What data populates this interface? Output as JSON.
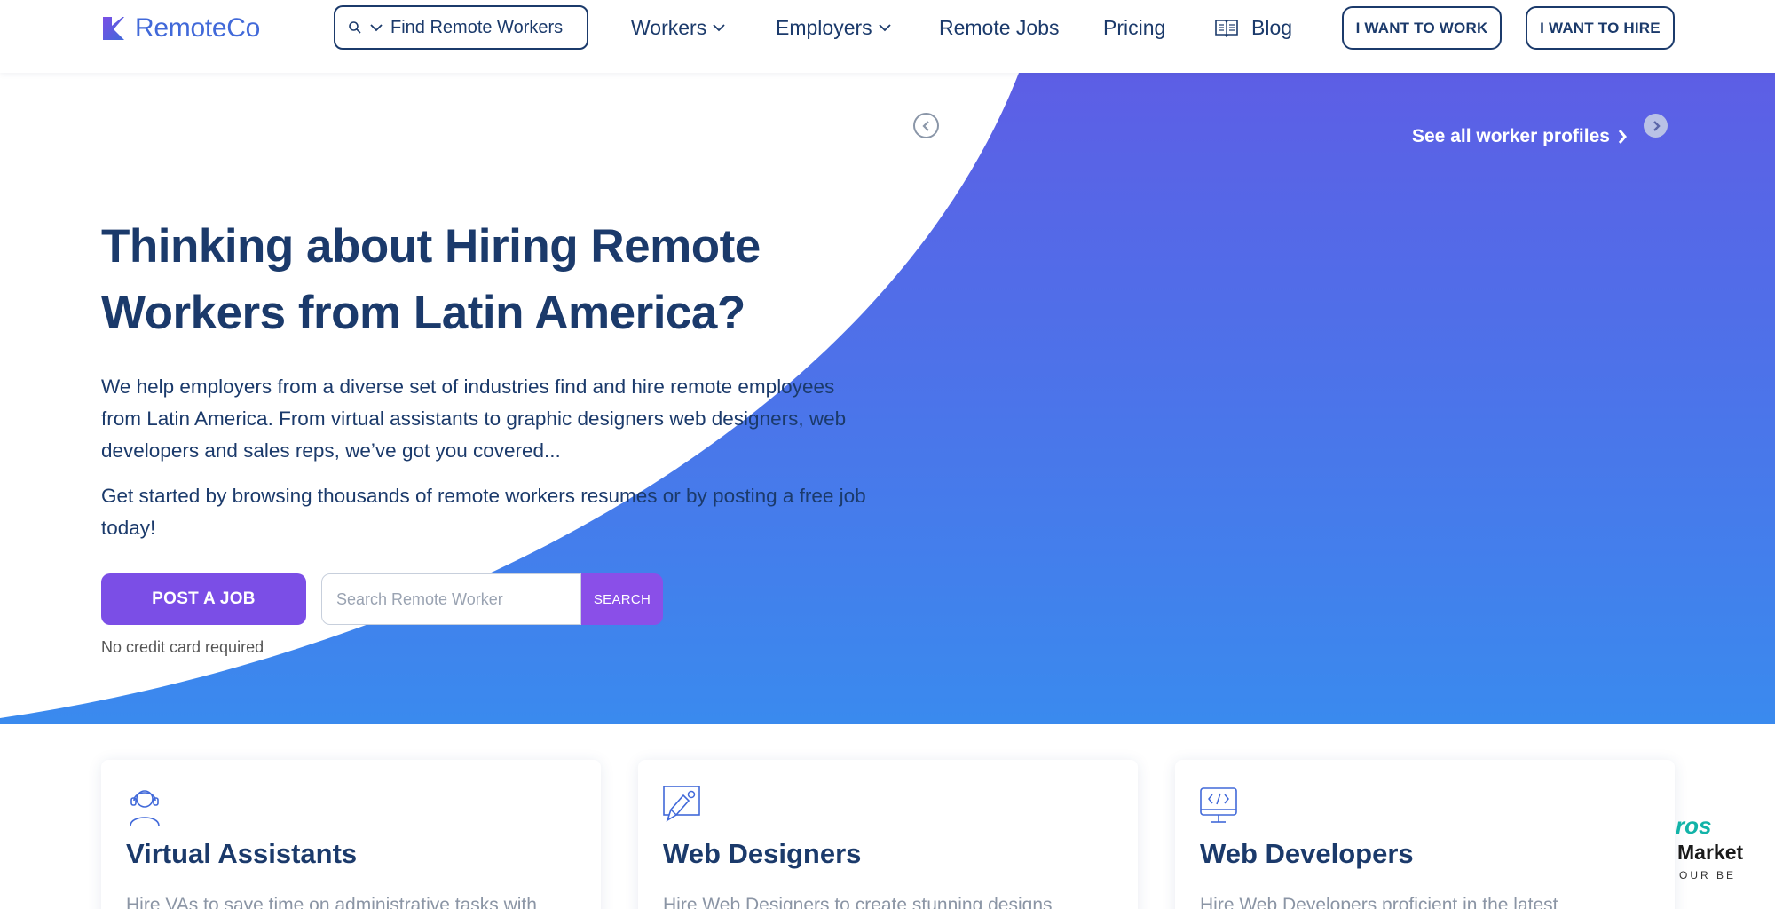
{
  "header": {
    "logo_text": "RemoteCo",
    "search_label": "Find Remote Workers",
    "nav": {
      "workers": "Workers",
      "employers": "Employers",
      "remote_jobs": "Remote Jobs",
      "pricing": "Pricing",
      "blog": "Blog"
    },
    "btn_work": "I WANT TO WORK",
    "btn_hire": "I WANT TO HIRE"
  },
  "hero": {
    "see_all": "See all worker profiles",
    "title": "Thinking about Hiring Remote Workers from Latin America?",
    "paragraph_1": "We help employers from a diverse set of industries find and hire remote employees from Latin America. From virtual assistants to graphic designers web designers, web developers and sales reps, we’ve got you covered...",
    "paragraph_2": "Get started by browsing thousands of remote workers resumes or by posting a free job today!",
    "post_job": "POST A JOB",
    "search_placeholder": "Search Remote Worker",
    "search_button": "SEARCH",
    "no_credit_card": "No credit card required"
  },
  "cards": [
    {
      "icon": "headset-person-icon",
      "title": "Virtual Assistants",
      "desc": "Hire VAs to save time on administrative tasks with"
    },
    {
      "icon": "design-tool-icon",
      "title": "Web Designers",
      "desc": "Hire Web Designers to create stunning designs"
    },
    {
      "icon": "code-monitor-icon",
      "title": "Web Developers",
      "desc": "Hire Web Developers proficient in the latest"
    }
  ],
  "badge": {
    "top": "ros",
    "middle": "Market",
    "bottom": "OUR BE"
  },
  "colors": {
    "navy": "#1b3a6b",
    "brand_blue": "#4169d9",
    "purple": "#7b4ee6",
    "hero_gradient_top": "#5d5ee5",
    "hero_gradient_bottom": "#3a8aee"
  }
}
